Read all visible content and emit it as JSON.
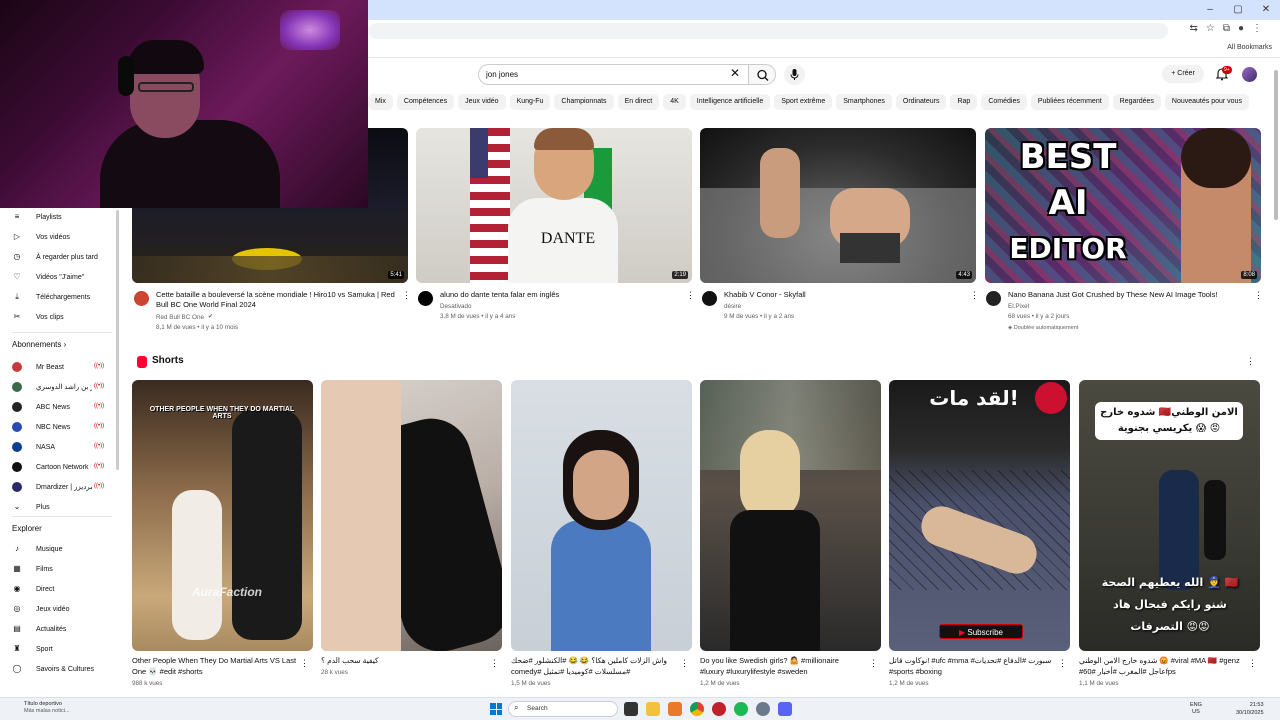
{
  "browser": {
    "window_controls": [
      "–",
      "▢",
      "✕"
    ],
    "bookmarks_all": "All Bookmarks"
  },
  "header": {
    "search_value": "jon jones",
    "create_label": "Créer",
    "notif_badge": "9+"
  },
  "chips": [
    "Mix",
    "Compétences",
    "Jeux vidéo",
    "Kung-Fu",
    "Championnats",
    "En direct",
    "4K",
    "Intelligence artificielle",
    "Sport extrême",
    "Smartphones",
    "Ordinateurs",
    "Rap",
    "Comédies",
    "Publiées récemment",
    "Regardées",
    "Nouveautés pour vous"
  ],
  "sidebar": {
    "you_items": [
      "Playlists",
      "Vos vidéos",
      "À regarder plus tard",
      "Vidéos \"J'aime\"",
      "Téléchargements",
      "Vos clips"
    ],
    "subscriptions_heading": "Abonnements",
    "subscriptions": [
      "Mr Beast",
      "ياسر بن راشد الدوسري",
      "ABC News",
      "NBC News",
      "NASA",
      "Cartoon Network",
      "Dmardizer | دمرديزر"
    ],
    "more_label": "Plus",
    "explore_heading": "Explorer",
    "explore_items": [
      "Musique",
      "Films",
      "Direct",
      "Jeux vidéo",
      "Actualités",
      "Sport",
      "Savoirs & Cultures"
    ]
  },
  "videos": [
    {
      "title": "Cette bataille a bouleversé la scène mondiale ! Hiro10 vs Samuka | Red Bull BC One World Final 2024",
      "channel": "Red Bull BC One",
      "meta": "8,1 M de vues • il y a 10 mois",
      "duration": "5:41"
    },
    {
      "title": "aluno do dante tenta falar em inglês",
      "channel": "Desativado",
      "meta": "3,8 M de vues • il y a 4 ans",
      "duration": "2:19"
    },
    {
      "title": "Khabib V Conor - Skyfall",
      "channel": "désire",
      "meta": "9 M de vues • il y a 2 ans",
      "duration": "4:43"
    },
    {
      "title": "Nano Banana Just Got Crushed by These New AI Image Tools!",
      "channel": "El.Pixel",
      "meta": "68 vues • il y a 2 jours",
      "extra": "Doublée automatiquement",
      "duration": "8:08"
    }
  ],
  "thumb_text": {
    "dante": "DANTE",
    "ai_editor": [
      "BEST",
      "AI",
      "EDITOR"
    ]
  },
  "shorts_heading": "Shorts",
  "shorts": [
    {
      "title": "Other People When They Do Martial Arts VS Last One 💀 #edit #shorts",
      "views": "988 k vues",
      "overlay": "OTHER PEOPLE WHEN THEY DO MARTIAL ARTS",
      "overlay2": "AuraFaction"
    },
    {
      "title": "كيفية سحب الدم ؟",
      "views": "28 k vues"
    },
    {
      "title": "واش الزلات كاملين هكا؟ 😂 😂 #الكنشلور #ضحك #مسلسلات #كوميديا #تمثيل #comedy",
      "views": "1,5 M de vues"
    },
    {
      "title": "Do you like Swedish girls? 🤷 #millionaire #luxury #luxurylifestyle #sweden",
      "views": "1,2 M de vues"
    },
    {
      "title": "نوكاوت قاتل! #ufc #mma #سبورت #الدفاع #تحديات #sports #boxing",
      "views": "1,2 M de vues",
      "overlay": "لقد مات!",
      "subscribe": "Subscribe"
    },
    {
      "title": "شدوه خارج الامن الوطني 😡 #viral #MA 🇲🇦 #genz #عاجل #المغرب #أخبار #60fps",
      "views": "1,1 M de vues",
      "overlay": "شدوه خارج 🇲🇦الامن الوطني 😱 يكريسي بجنوية 😡",
      "overlay_bottom": "الله يعطيهم الصحة 👮 🇲🇦 شنو رايكم فبحال هاد التصرفات 😡😡"
    }
  ],
  "taskbar": {
    "weather_title": "Título deportivo",
    "weather_sub": "Más malas notici...",
    "search_label": "Search",
    "lang": "ENG",
    "region": "US",
    "time": "21:53",
    "date": "30/10/2025"
  }
}
